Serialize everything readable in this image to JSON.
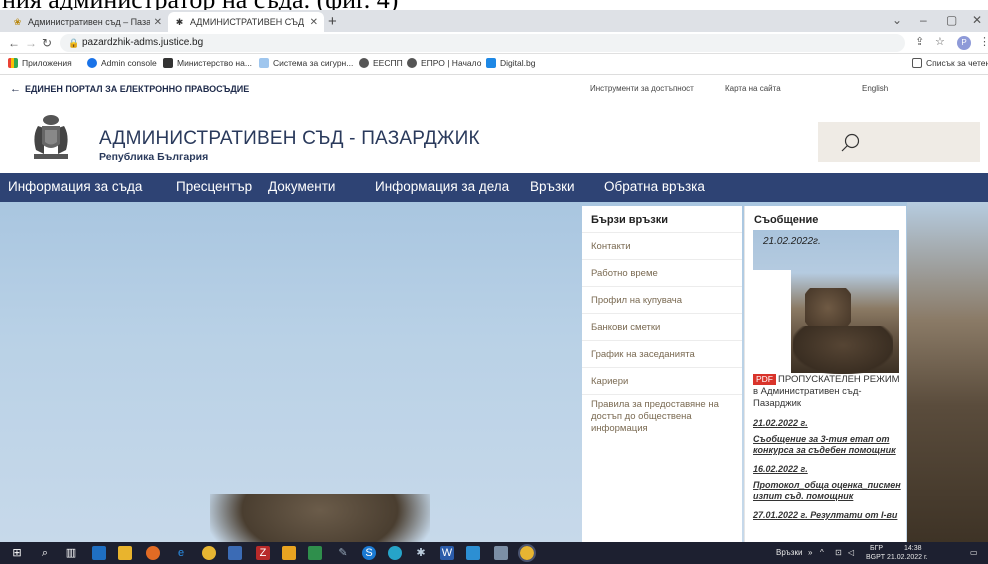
{
  "doc_caption": "ния администратор на съда. (фиг. 4)",
  "browser": {
    "tabs": [
      {
        "label": "Административен съд – Пазард",
        "favicon": "crest-icon"
      },
      {
        "label": "АДМИНИСТРАТИВЕН СЪД ПАЗ",
        "favicon": "crest-icon"
      }
    ],
    "url": "pazardzhik-adms.justice.bg",
    "profile_initial": "P",
    "bookmarks": [
      {
        "label": "Приложения",
        "icon": "apps-icon",
        "color": "#4285f4"
      },
      {
        "label": "Admin console",
        "icon": "admin-icon",
        "color": "#1a73e8"
      },
      {
        "label": "Министерство на...",
        "icon": "crest-icon",
        "color": "#333333"
      },
      {
        "label": "Система за сигурн...",
        "icon": "doc-icon",
        "color": "#6aa7e8"
      },
      {
        "label": "ЕЕСПП",
        "icon": "globe-icon",
        "color": "#555555"
      },
      {
        "label": "ЕПРО | Начало",
        "icon": "globe-icon",
        "color": "#555555"
      },
      {
        "label": "Digital.bg",
        "icon": "digital-icon",
        "color": "#1e88e5"
      }
    ],
    "reading_list": "Списък за четене"
  },
  "portal": {
    "title": "ЕДИНЕН ПОРТАЛ ЗА ЕЛЕКТРОННО ПРАВОСЪДИЕ",
    "accessibility": "Инструменти за достъпност",
    "sitemap": "Карта на сайта",
    "english": "English"
  },
  "header": {
    "court_name": "АДМИНИСТРАТИВЕН СЪД - ПАЗАРДЖИК",
    "country": "Република България"
  },
  "nav": [
    "Информация за съда",
    "Пресцентър",
    "Документи",
    "Информация за дела",
    "Връзки",
    "Обратна връзка"
  ],
  "quick_links": {
    "title": "Бързи връзки",
    "items": [
      "Контакти",
      "Работно време",
      "Профил на купувача",
      "Банкови сметки",
      "График на заседанията",
      "Кариери",
      "Правила за предоставяне на достъп до обществена информация"
    ]
  },
  "message": {
    "title": "Съобщение",
    "photo_date": "21.02.2022г.",
    "pdf_label": "PDF",
    "pdf_text": "ПРОПУСКАТЕЛЕН РЕЖИМ в Административен съд-Пазарджик",
    "entries": [
      {
        "date": "21.02.2022 г.",
        "text": "Съобщение за 3-тия етап от конкурса за съдебен помощник"
      },
      {
        "date": "16.02.2022 г.",
        "text": "Протокол_обща оценка_писмен изпит съд. помощник"
      },
      {
        "date": "27.01.2022 г. Резултати от I-ви",
        "text": ""
      }
    ]
  },
  "taskbar": {
    "links_label": "Връзки",
    "lang": "БГР",
    "layout": "BGPT",
    "time": "14:38",
    "date": "21.02.2022 г."
  }
}
